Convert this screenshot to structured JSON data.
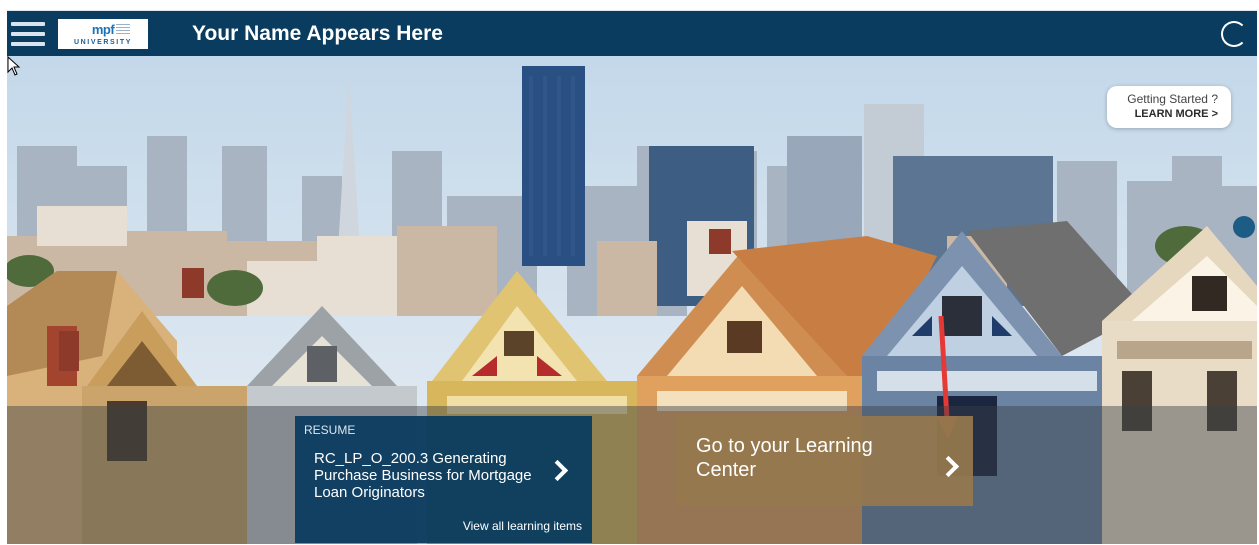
{
  "header": {
    "logo_mark": "mpf",
    "logo_subtitle": "UNIVERSITY",
    "title": "Your Name Appears Here",
    "menu_icon": "hamburger-menu-icon",
    "loading_icon": "loading-spinner-icon"
  },
  "help": {
    "question": "Getting Started ?",
    "link": "LEARN MORE >"
  },
  "resume_card": {
    "tag": "RESUME",
    "course_title": "RC_LP_O_200.3 Generating Purchase Business for Mortgage Loan Originators",
    "view_all_link": "View all learning items",
    "icon": "chevron-right-icon"
  },
  "learning_center_card": {
    "label": "Go to your Learning Center",
    "icon": "chevron-right-icon"
  },
  "annotation": {
    "icon": "red-arrow-icon",
    "color": "#e53935"
  },
  "colors": {
    "header_bg": "#0a3c60",
    "resume_card_bg": "#0b3c60",
    "learning_card_bg": "#96784e",
    "sky": "#cfe0ee"
  }
}
